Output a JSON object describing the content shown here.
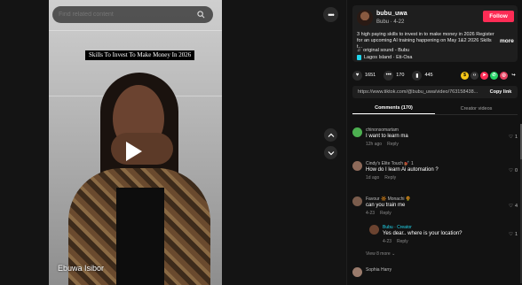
{
  "video": {
    "search_placeholder": "Find related content",
    "caption": "Skills To Invest To Make Money In 2026",
    "watermark": "Ebuwa Isibor"
  },
  "post": {
    "username": "bubu_uwa",
    "nickname_date": "Bubu · 4-22",
    "follow_label": "Follow",
    "description": "3 high paying skills to invest in to make money in 2026 Register for an upcoming AI training happening on May 1&2 2026 Skills t...",
    "more_label": "more",
    "sound": "original sound - Bubu",
    "location": "Lagos Island · Eti-Osa"
  },
  "stats": {
    "likes": "1651",
    "comments": "170",
    "saves": "445"
  },
  "share_colors": [
    "#f5c518",
    "#333333",
    "#fe2c55",
    "#25d366",
    "#e4405f",
    "#ffffff"
  ],
  "link": {
    "url": "https://www.tiktok.com/@bubu_uwa/video/763158438...",
    "copy_label": "Copy link"
  },
  "tabs": [
    {
      "label": "Comments (170)",
      "active": true
    },
    {
      "label": "Creator videos",
      "active": false
    }
  ],
  "comments": [
    {
      "user": "chinonsomartam",
      "text": "I want to learn ma",
      "time": "12h ago",
      "reply": "Reply",
      "likes": "1",
      "color": "#4caf50"
    },
    {
      "user": "Cindy's Elite Touch 💅🏾 1",
      "text": "How do I learn Ai automation ?",
      "time": "1d ago",
      "reply": "Reply",
      "likes": "0",
      "color": "#8e6a5a"
    },
    {
      "user": "Favour 🔆 Monachi 🌻",
      "text": "can you train me",
      "time": "4-23",
      "reply": "Reply",
      "likes": "4",
      "color": "#7a5c4c"
    },
    {
      "user": "Bubu · Creator",
      "text": "Yes dear.. where is your location?",
      "time": "4-23",
      "reply": "Reply",
      "likes": "1",
      "color": "#6b4330"
    }
  ],
  "view_more": "View 8 more",
  "last_user": "Sophia Harry"
}
